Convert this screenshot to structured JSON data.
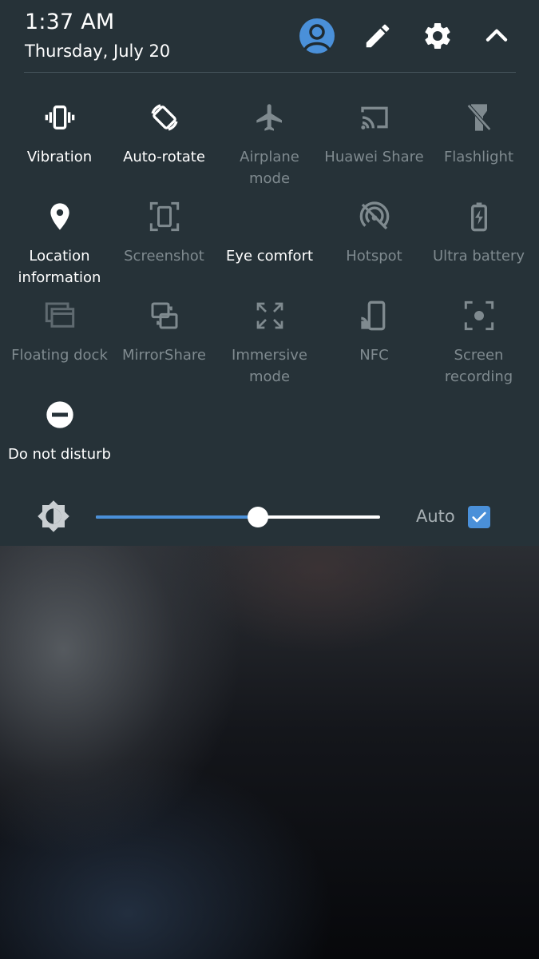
{
  "header": {
    "time": "1:37 AM",
    "date": "Thursday, July 20",
    "icons": [
      "avatar-icon",
      "edit-icon",
      "settings-icon",
      "collapse-icon"
    ]
  },
  "tiles": [
    {
      "label": "Vibration",
      "icon": "vibration-icon",
      "active": true
    },
    {
      "label": "Auto-rotate",
      "icon": "auto-rotate-icon",
      "active": true
    },
    {
      "label": "Airplane mode",
      "icon": "airplane-icon",
      "active": false
    },
    {
      "label": "Huawei Share",
      "icon": "cast-icon",
      "active": false
    },
    {
      "label": "Flashlight",
      "icon": "flashlight-icon",
      "active": false
    },
    {
      "label": "Location\ninformation",
      "icon": "location-icon",
      "active": true
    },
    {
      "label": "Screenshot",
      "icon": "screenshot-icon",
      "active": false
    },
    {
      "label": "Eye comfort",
      "icon": "moon-icon",
      "active": true
    },
    {
      "label": "Hotspot",
      "icon": "hotspot-off-icon",
      "active": false
    },
    {
      "label": "Ultra battery",
      "icon": "battery-icon",
      "active": false
    },
    {
      "label": "Floating dock",
      "icon": "floating-dock-icon",
      "active": false
    },
    {
      "label": "MirrorShare",
      "icon": "mirror-share-icon",
      "active": false
    },
    {
      "label": "Immersive\nmode",
      "icon": "immersive-icon",
      "active": false
    },
    {
      "label": "NFC",
      "icon": "nfc-icon",
      "active": false
    },
    {
      "label": "Screen\nrecording",
      "icon": "screen-recording-icon",
      "active": false
    },
    {
      "label": "Do not disturb",
      "icon": "do-not-disturb-icon",
      "active": true
    }
  ],
  "brightness": {
    "icon": "brightness-icon",
    "level": 0.57,
    "auto_label": "Auto",
    "auto_checked": true
  },
  "colors": {
    "panel": "#263238",
    "accent": "#4a90d9",
    "active_text": "#ffffff",
    "inactive_text": "#7f8a8f"
  }
}
